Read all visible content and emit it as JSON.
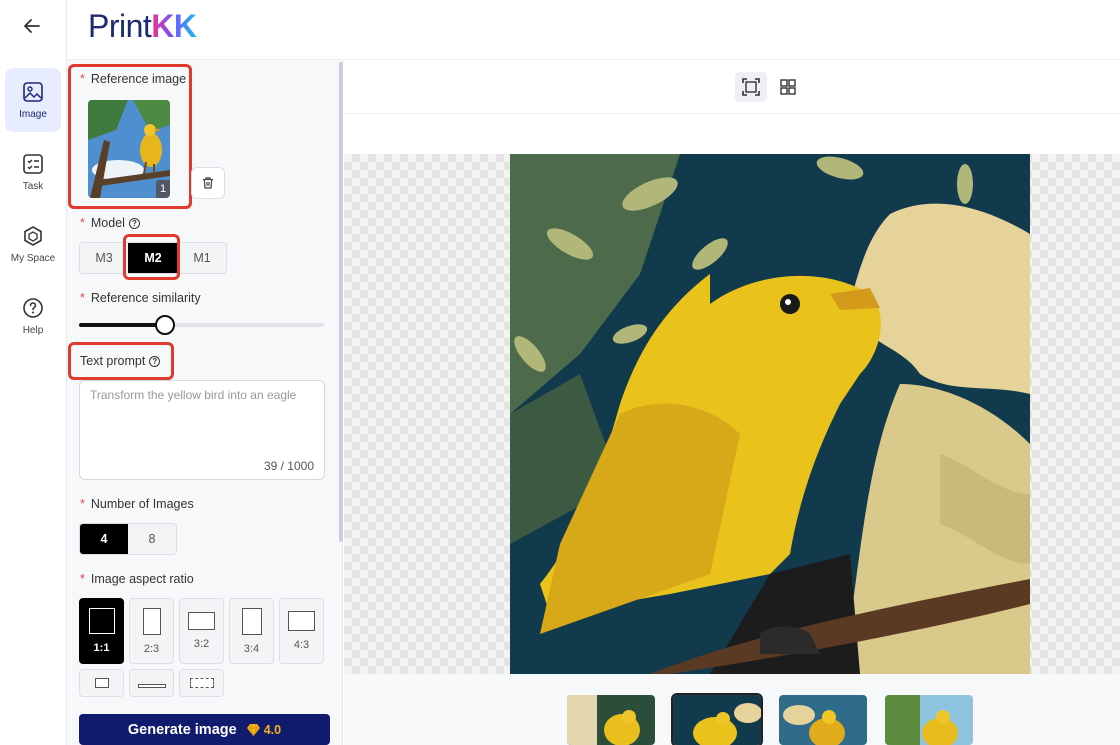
{
  "nav": {
    "back_icon": "arrow-left-icon",
    "items": [
      {
        "label": "Image",
        "icon": "image-icon",
        "active": true
      },
      {
        "label": "Task",
        "icon": "task-list-icon",
        "active": false
      },
      {
        "label": "My Space",
        "icon": "cube-icon",
        "active": false
      },
      {
        "label": "Help",
        "icon": "question-circle-icon",
        "active": false
      }
    ]
  },
  "header": {
    "logo_text": "Print",
    "logo_accent": "KK"
  },
  "panel": {
    "reference_image": {
      "label": "Reference image",
      "count_badge": "1"
    },
    "model": {
      "label": "Model",
      "options": [
        "M3",
        "M2",
        "M1"
      ],
      "selected": "M2"
    },
    "similarity": {
      "label": "Reference similarity",
      "value": 0.35
    },
    "prompt": {
      "label": "Text prompt",
      "placeholder": "Transform the yellow bird into an eagle",
      "counter": "39 / 1000"
    },
    "num_images": {
      "label": "Number of Images",
      "options": [
        "4",
        "8"
      ],
      "selected": "4"
    },
    "aspect": {
      "label": "Image aspect ratio",
      "options": [
        "1:1",
        "2:3",
        "3:2",
        "3:4",
        "4:3"
      ],
      "selected": "1:1"
    },
    "generate": {
      "label": "Generate image",
      "cost": "4.0"
    }
  },
  "colors": {
    "accent": "#111b6e",
    "highlight": "#e03a2e",
    "active_nav": "#e7ecff"
  }
}
